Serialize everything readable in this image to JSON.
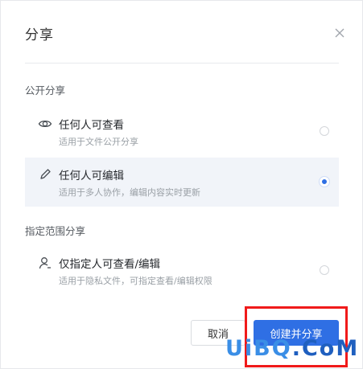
{
  "dialog": {
    "title": "分享",
    "close_icon": "close-icon"
  },
  "sections": {
    "public_label": "公开分享",
    "restricted_label": "指定范围分享"
  },
  "options": [
    {
      "icon": "eye-icon",
      "title": "任何人可查看",
      "desc": "适用于文件公开分享",
      "selected": false
    },
    {
      "icon": "pencil-icon",
      "title": "任何人可编辑",
      "desc": "适用于多人协作，编辑内容实时更新",
      "selected": true
    },
    {
      "icon": "user-icon",
      "title": "仅指定人可查看/编辑",
      "desc": "适用于隐私文件，可指定查看/编辑权限",
      "selected": false
    }
  ],
  "buttons": {
    "cancel_label": "取消",
    "create_label": "创建并分享"
  },
  "watermark": {
    "part1": "UiBQ",
    "part2": ".CoM"
  },
  "colors": {
    "accent": "#2f6fe4",
    "selected_bg": "#f1f4f9",
    "highlight": "#f01a1a"
  }
}
